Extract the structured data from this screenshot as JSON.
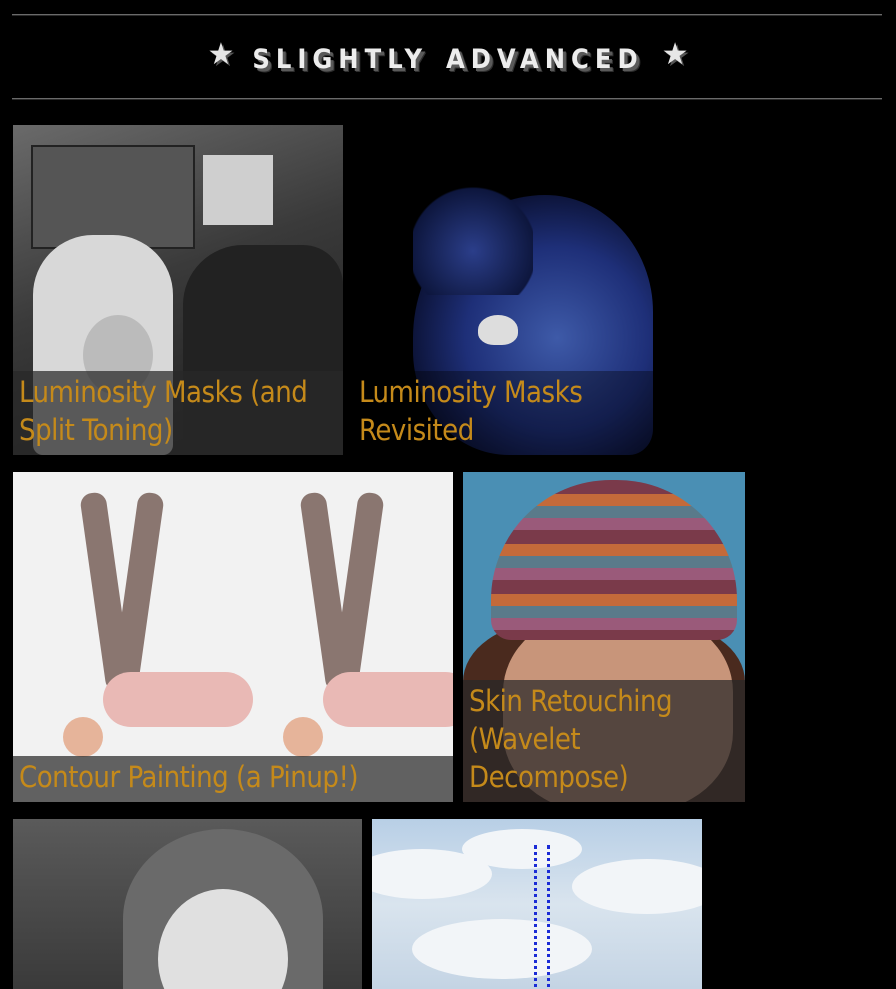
{
  "header": {
    "title": "Slightly Advanced",
    "star_left": "★",
    "star_right": "★"
  },
  "cards": [
    {
      "caption": "Luminosity Masks (and Split Toning)"
    },
    {
      "caption": "Luminosity Masks Revisited"
    },
    {
      "caption": "Contour Painting (a Pinup!)"
    },
    {
      "caption": "Skin Retouching (Wavelet Decompose)"
    },
    {
      "caption": ""
    },
    {
      "caption": ""
    }
  ],
  "colors": {
    "background": "#000000",
    "caption_text": "#c58a1a",
    "caption_bg": "rgba(40,40,40,0.72)",
    "title_text": "#ededed"
  }
}
